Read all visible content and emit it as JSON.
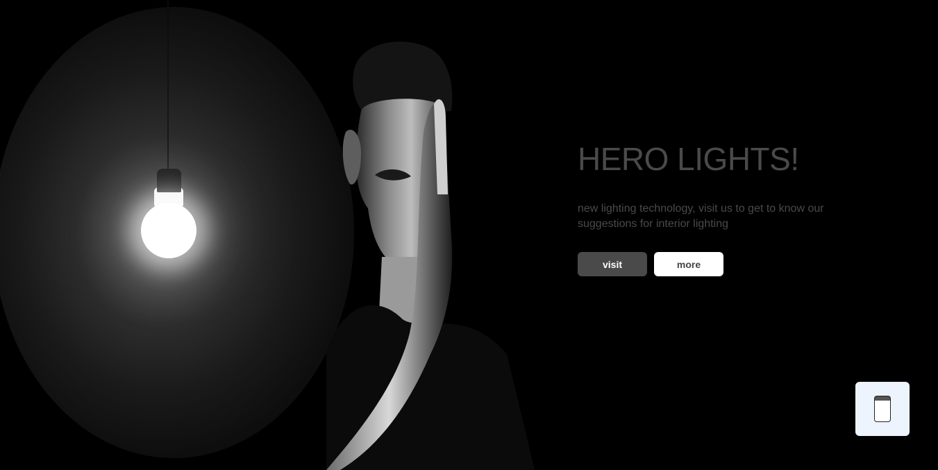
{
  "hero": {
    "title": "HERO LIGHTS!",
    "description": "new lighting technology, visit us to get to know our suggestions for interior lighting",
    "buttons": {
      "visit_label": "visit",
      "more_label": "more"
    }
  },
  "widget": {
    "icon": "phone-icon"
  },
  "colors": {
    "background": "#000000",
    "text_muted": "#4a4a4a",
    "button_primary": "#4a4a4a",
    "button_secondary": "#ffffff",
    "widget_bg": "#eef4fd"
  }
}
